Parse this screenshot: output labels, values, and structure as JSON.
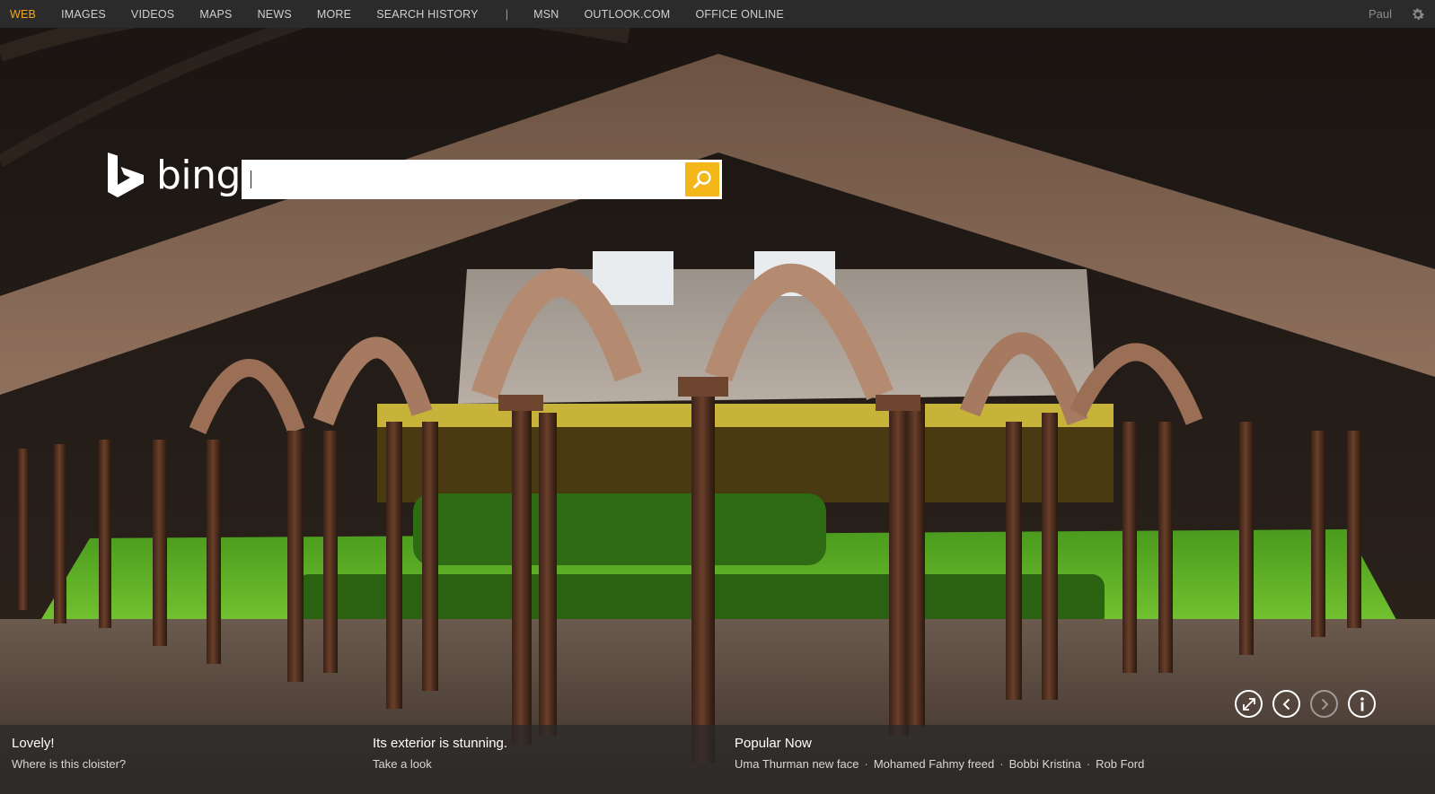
{
  "nav": {
    "items": [
      {
        "label": "WEB",
        "active": true
      },
      {
        "label": "IMAGES"
      },
      {
        "label": "VIDEOS"
      },
      {
        "label": "MAPS"
      },
      {
        "label": "NEWS"
      },
      {
        "label": "MORE"
      },
      {
        "label": "SEARCH HISTORY"
      }
    ],
    "separator": "|",
    "links": [
      {
        "label": "MSN"
      },
      {
        "label": "OUTLOOK.COM"
      },
      {
        "label": "OFFICE ONLINE"
      }
    ],
    "user": "Paul",
    "settings_icon": "gear-icon"
  },
  "brand": {
    "logo_text": "bing",
    "accent_color": "#f4b71a"
  },
  "search": {
    "value": "",
    "placeholder": "",
    "button_icon": "magnifier-icon"
  },
  "image_controls": [
    {
      "icon": "expand-icon"
    },
    {
      "icon": "chevron-left-icon"
    },
    {
      "icon": "chevron-right-icon",
      "disabled": true
    },
    {
      "icon": "info-icon"
    }
  ],
  "hotspots": [
    {
      "title": "Lovely!",
      "sub": "Where is this cloister?"
    },
    {
      "title": "Its exterior is stunning.",
      "sub": "Take a look"
    }
  ],
  "popular": {
    "title": "Popular Now",
    "items": [
      "Uma Thurman new face",
      "Mohamed Fahmy freed",
      "Bobbi Kristina",
      "Rob Ford"
    ]
  }
}
